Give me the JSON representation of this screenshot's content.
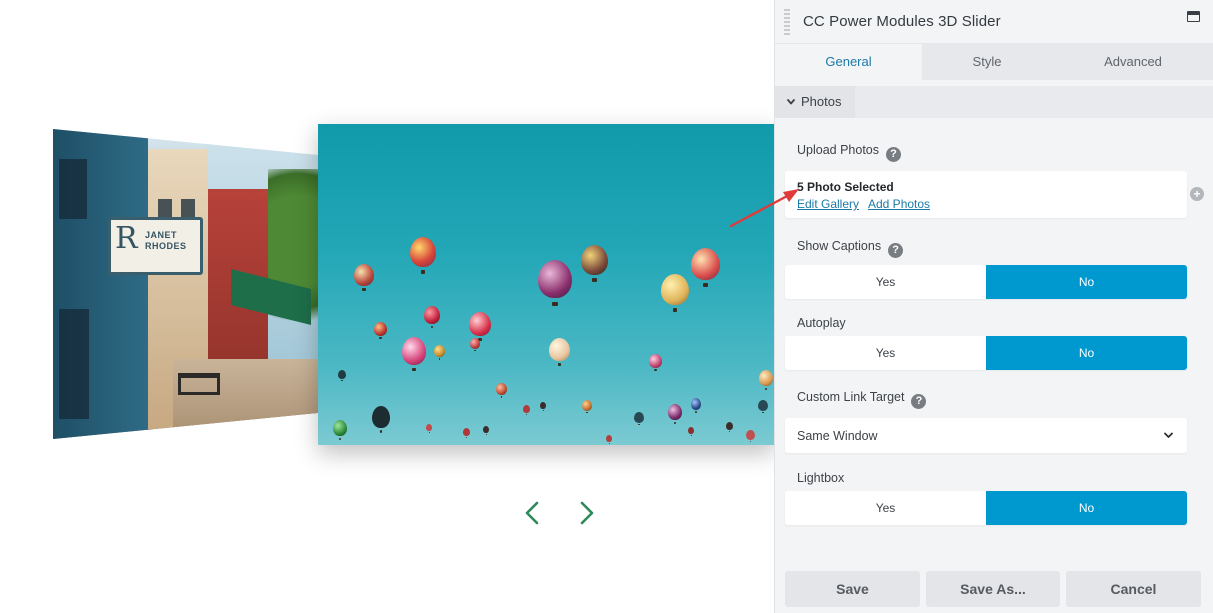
{
  "panel": {
    "title": "CC Power Modules 3D Slider",
    "tabs": [
      {
        "label": "General",
        "active": true
      },
      {
        "label": "Style",
        "active": false
      },
      {
        "label": "Advanced",
        "active": false
      }
    ],
    "section": {
      "label": "Photos",
      "expanded": true
    },
    "upload_photos": {
      "label": "Upload Photos",
      "count_text": "5 Photo Selected",
      "edit_link": "Edit Gallery",
      "add_link": "Add Photos"
    },
    "show_captions": {
      "label": "Show Captions",
      "yes": "Yes",
      "no": "No",
      "selected": "No"
    },
    "autoplay": {
      "label": "Autoplay",
      "yes": "Yes",
      "no": "No",
      "selected": "No"
    },
    "custom_link_target": {
      "label": "Custom Link Target",
      "value": "Same Window"
    },
    "lightbox": {
      "label": "Lightbox",
      "yes": "Yes",
      "no": "No",
      "selected": "No"
    },
    "footer": {
      "save": "Save",
      "save_as": "Save As...",
      "cancel": "Cancel"
    }
  },
  "preview": {
    "side_slide_sign": {
      "letter": "R",
      "name_line1": "JANET",
      "name_line2": "RHODES"
    }
  },
  "colors": {
    "accent_blue": "#0099cf",
    "link_blue": "#1b7aa6",
    "nav_arrow_green": "#2d8a5a",
    "annotation_red": "#e03a3a"
  },
  "icons": {
    "help": "question-circle-icon",
    "add_photo": "plus-circle-icon",
    "maximize": "window-maximize-icon",
    "section_toggle": "chevron-down-icon",
    "select": "chevron-down-icon",
    "prev": "chevron-left-icon",
    "next": "chevron-right-icon"
  }
}
